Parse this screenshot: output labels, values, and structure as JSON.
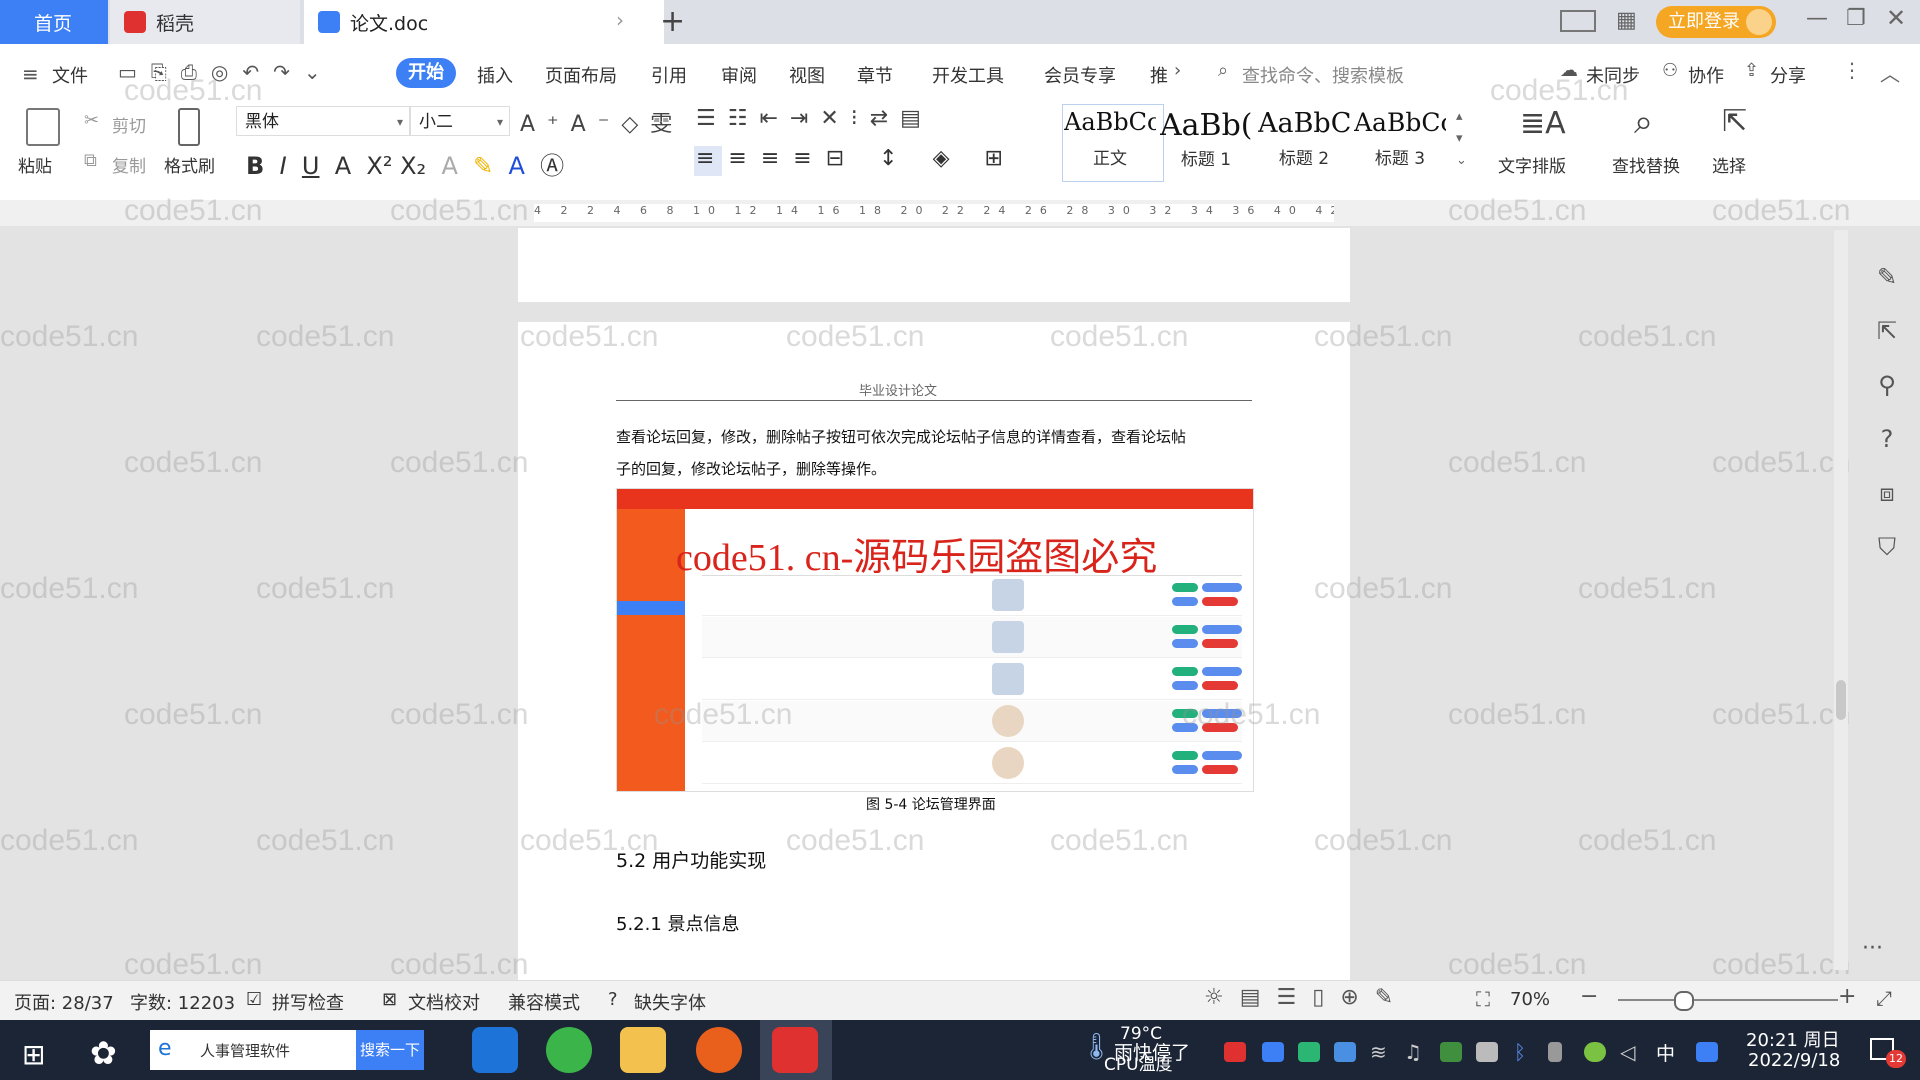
{
  "tabs": {
    "home": "首页",
    "daoke": "稻壳",
    "doc": "论文.doc"
  },
  "titlebar": {
    "login": "立即登录"
  },
  "menu": {
    "file": "文件",
    "start": "开始",
    "items": [
      "插入",
      "页面布局",
      "引用",
      "审阅",
      "视图",
      "章节",
      "开发工具",
      "会员专享",
      "推"
    ],
    "search_cmd": "查找命令、搜索模板",
    "sync": "未同步",
    "collab": "协作",
    "share": "分享"
  },
  "ribbon": {
    "paste": "粘贴",
    "cut": "剪切",
    "copy": "复制",
    "format_painter": "格式刷",
    "font": "黑体",
    "size": "小二",
    "styles": [
      {
        "sample": "AaBbCcI",
        "name": "正文"
      },
      {
        "sample": "AaBb(",
        "name": "标题 1"
      },
      {
        "sample": "AaBbC",
        "name": "标题 2"
      },
      {
        "sample": "AaBbCc",
        "name": "标题 3"
      }
    ],
    "text_layout": "文字排版",
    "find_replace": "查找替换",
    "select": "选择"
  },
  "ruler": {
    "ticks": "4 2 2 4 6 8 10 12 14 16 18 20 22 24 26 28 30 32 34 36 40 42"
  },
  "document": {
    "header": "毕业设计论文",
    "paragraph_line1": "查看论坛回复，修改，删除帖子按钮可依次完成论坛帖子信息的详情查看，查看论坛帖",
    "paragraph_line2": "子的回复，修改论坛帖子，删除等操作。",
    "figure_overlay": "code51. cn-源码乐园盗图必究",
    "figure_caption": "图 5-4  论坛管理界面",
    "heading_52": "5.2 用户功能实现",
    "heading_521": "5.2.1  景点信息"
  },
  "watermark": "code51.cn",
  "status": {
    "page": "页面: 28/37",
    "words": "字数: 12203",
    "spell": "拼写检查",
    "proof": "文档校对",
    "compat": "兼容模式",
    "missing_font": "缺失字体",
    "zoom": "70%"
  },
  "taskbar": {
    "search_text": "人事管理软件",
    "search_btn": "搜索一下",
    "weather": "79°C",
    "weather_sub": "CPU温度",
    "rain": "雨快停了",
    "ime": "中",
    "time": "20:21 周日",
    "date": "2022/9/18",
    "notif": "12"
  },
  "colors": {
    "accent": "#3d7ff5",
    "login": "#f5a623",
    "figure_red": "#e8341c",
    "overlay_text": "#d9241b"
  }
}
